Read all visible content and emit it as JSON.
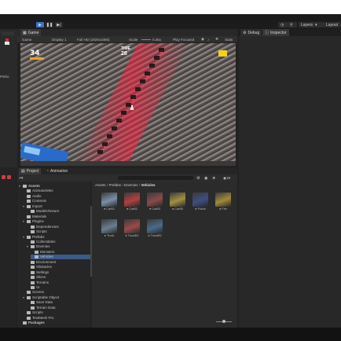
{
  "toolbar": {
    "play_icon": "play-icon",
    "pause_icon": "pause-icon",
    "step_icon": "step-icon",
    "search_icon": "search-icon",
    "layers_label": "Layers",
    "layout_label": "Layout"
  },
  "scene_tab": {
    "label": "Game"
  },
  "left_panel": {
    "item": "Pieho"
  },
  "game_bar": {
    "mode": "Game",
    "display": "Display 1",
    "resolution": "Full HD (1920x1080)",
    "scale_label": "Scale",
    "scale_value": "0.36x",
    "play_focused": "Play Focused",
    "stats": "Stats"
  },
  "game_hud": {
    "score": "34",
    "time_label": "TIME",
    "time_value": "28"
  },
  "inspector": {
    "debug_tab": "Debug",
    "inspector_tab": "Inspector"
  },
  "project": {
    "project_tab": "Project",
    "animation_tab": "Animation",
    "breadcrumb": [
      "Assets",
      "Prefabs",
      "Enemies",
      "Vehicles"
    ],
    "zoom_value": "19"
  },
  "tree": [
    {
      "label": "Assets",
      "depth": 0,
      "expanded": true,
      "bold": true
    },
    {
      "label": "AnimatorMes",
      "depth": 1
    },
    {
      "label": "Audio",
      "depth": 1
    },
    {
      "label": "Contents",
      "depth": 1
    },
    {
      "label": "Import",
      "depth": 1,
      "expanded": true
    },
    {
      "label": "ModelsTexture",
      "depth": 2
    },
    {
      "label": "Materials",
      "depth": 1
    },
    {
      "label": "Plugins",
      "depth": 1,
      "expanded": true
    },
    {
      "label": "Dependencies",
      "depth": 2
    },
    {
      "label": "Scripts",
      "depth": 2
    },
    {
      "label": "Prefabs",
      "depth": 1,
      "expanded": true
    },
    {
      "label": "Collectables",
      "depth": 2
    },
    {
      "label": "Enemies",
      "depth": 2,
      "expanded": true
    },
    {
      "label": "Monsters",
      "depth": 3
    },
    {
      "label": "Vehicles",
      "depth": 3,
      "selected": true
    },
    {
      "label": "Environment",
      "depth": 2
    },
    {
      "label": "Obstacles",
      "depth": 2
    },
    {
      "label": "Settings",
      "depth": 2
    },
    {
      "label": "Slices",
      "depth": 2
    },
    {
      "label": "Terrains",
      "depth": 2
    },
    {
      "label": "UI",
      "depth": 2
    },
    {
      "label": "Scenes",
      "depth": 1
    },
    {
      "label": "Scriptable Object",
      "depth": 1,
      "expanded": true
    },
    {
      "label": "Save Data",
      "depth": 2
    },
    {
      "label": "Terrain Data",
      "depth": 2
    },
    {
      "label": "Scripts",
      "depth": 1
    },
    {
      "label": "TextMesh Pro",
      "depth": 1
    },
    {
      "label": "Packages",
      "depth": 0,
      "bold": true
    }
  ],
  "assets": [
    {
      "label": "CarB1",
      "color": "#7a8fa8"
    },
    {
      "label": "CarB2",
      "color": "#b04040"
    },
    {
      "label": "CarB3",
      "color": "#8a4a4a"
    },
    {
      "label": "CarB5",
      "color": "#a09040"
    },
    {
      "label": "Police",
      "color": "#3c4f80"
    },
    {
      "label": "Fire",
      "color": "#a08a3a"
    },
    {
      "label": "Truck",
      "color": "#6a7d90"
    },
    {
      "label": "TruckB1",
      "color": "#9a4a4a"
    },
    {
      "label": "TruckB2",
      "color": "#4a6a8a"
    }
  ],
  "colors": {
    "accent": "#3a72c8",
    "enemy_red": "#e0304a",
    "hud_yellow": "#f0d020"
  }
}
